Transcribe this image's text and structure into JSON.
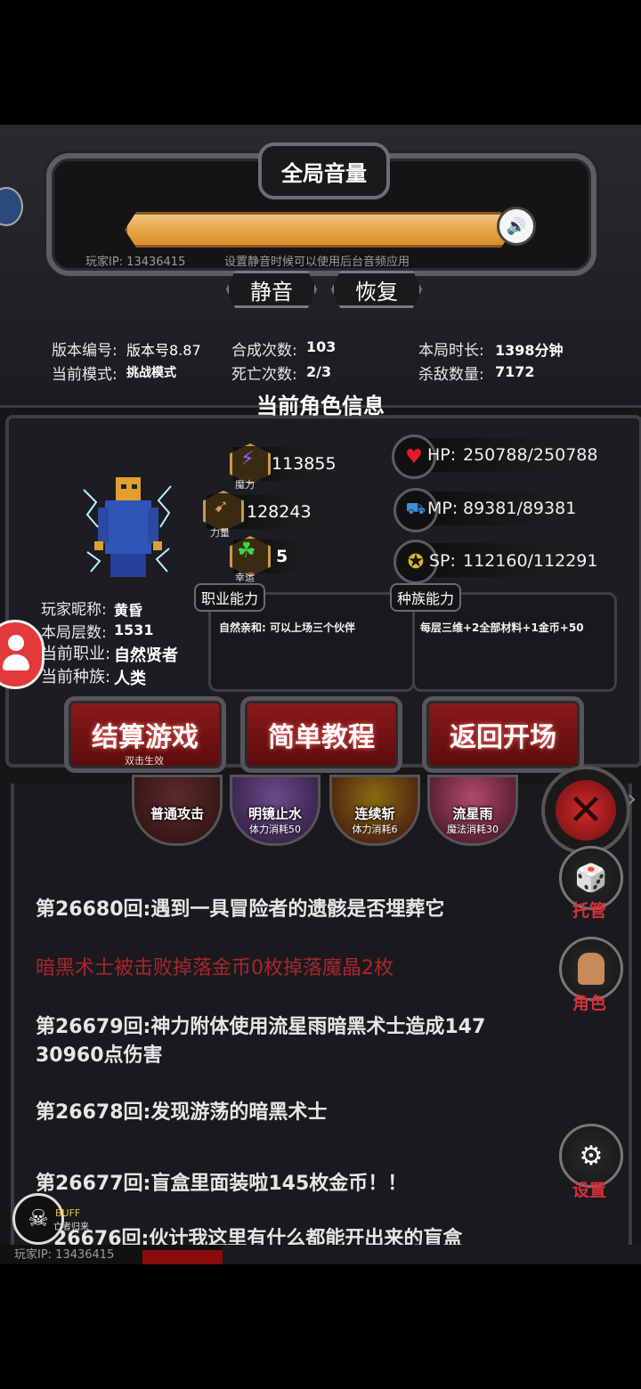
{
  "volume_panel": {
    "title": "全局音量",
    "volume_level": 1.0,
    "player_ip_label": "玩家IP: 13436415",
    "hint": "设置静音时候可以使用后台音频应用",
    "mute_label": "静音",
    "restore_label": "恢复"
  },
  "game_stats": {
    "version_label": "版本编号:",
    "version_value": "版本号8.87",
    "mode_label": "当前模式:",
    "mode_value": "挑战模式",
    "synth_label": "合成次数:",
    "synth_value": "103",
    "death_label": "死亡次数:",
    "death_value": "2/3",
    "duration_label": "本局时长:",
    "duration_value": "1398分钟",
    "kills_label": "杀敌数量:",
    "kills_value": "7172"
  },
  "character": {
    "section_title": "当前角色信息",
    "magic_value": "113855",
    "magic_label": "魔力",
    "strength_value": "128243",
    "strength_label": "力量",
    "luck_value": "5",
    "luck_label": "幸运",
    "hp_label": "HP:",
    "hp_value": "250788/250788",
    "mp_label": "MP:",
    "mp_value": "89381/89381",
    "sp_label": "SP:",
    "sp_value": "112160/112291",
    "nickname_label": "玩家昵称:",
    "nickname_value": "黄昏",
    "floor_label": "本局层数:",
    "floor_value": "1531",
    "job_label": "当前职业:",
    "job_value": "自然贤者",
    "race_label": "当前种族:",
    "race_value": "人类",
    "job_ability_title": "职业能力",
    "job_ability_text": "自然亲和: 可以上场三个伙伴",
    "race_ability_title": "种族能力",
    "race_ability_text": "每层三维+2全部材料+1金币+50"
  },
  "actions": {
    "settle_label": "结算游戏",
    "settle_hint": "双击生效",
    "tutorial_label": "简单教程",
    "return_label": "返回开场"
  },
  "skills": [
    {
      "name": "普通攻击",
      "cost": ""
    },
    {
      "name": "明镜止水",
      "cost": "体力消耗50"
    },
    {
      "name": "连续斩",
      "cost": "体力消耗6"
    },
    {
      "name": "流星雨",
      "cost": "魔法消耗30"
    }
  ],
  "log": [
    {
      "text": "第26680回:遇到一具冒险者的遗骸是否埋葬它",
      "color": "#e6e6e6"
    },
    {
      "text": "暗黑术士被击败掉落金币0枚掉落魔晶2枚",
      "color": "#a8262a"
    },
    {
      "text": "第26679回:神力附体使用流星雨暗黑术士造成147",
      "color": "#e6e6e6"
    },
    {
      "text": "30960点伤害",
      "color": "#e6e6e6"
    },
    {
      "text": "第26678回:发现游荡的暗黑术士",
      "color": "#e6e6e6"
    },
    {
      "text": "第26677回:盲盒里面装啦145枚金币！！",
      "color": "#e6e6e6"
    },
    {
      "text": "26676回:伙计我这里有什么都能开出来的盲盒",
      "color": "#e6e6e6"
    }
  ],
  "side_buttons": {
    "auto_label": "托管",
    "role_label": "角色",
    "settings_label": "设置"
  },
  "buff": {
    "label": "BUFF",
    "name": "亡者归来"
  },
  "footer": {
    "player_ip": "玩家IP: 13436415"
  }
}
